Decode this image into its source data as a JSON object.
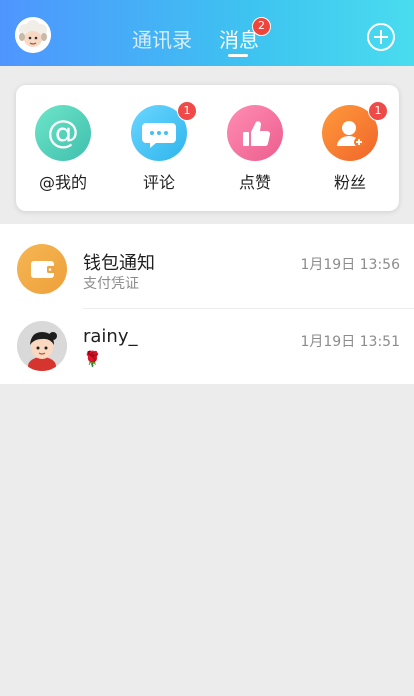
{
  "header": {
    "tabs": [
      {
        "label": "通讯录",
        "active": false
      },
      {
        "label": "消息",
        "active": true,
        "badge": "2"
      }
    ],
    "avatar_icon": "sheep-avatar",
    "add_icon": "plus-circle-icon"
  },
  "shortcuts": [
    {
      "label": "@我的",
      "icon": "at-icon",
      "color": "#4fd0b8",
      "badge": ""
    },
    {
      "label": "评论",
      "icon": "comment-icon",
      "color": "#3fc3f2",
      "badge": "1"
    },
    {
      "label": "点赞",
      "icon": "thumbs-up-icon",
      "color": "#f16b9a",
      "badge": ""
    },
    {
      "label": "粉丝",
      "icon": "fan-add-icon",
      "color": "#f57a2a",
      "badge": "1"
    }
  ],
  "messages": [
    {
      "title": "钱包通知",
      "subtitle": "支付凭证",
      "time": "1月19日 13:56",
      "avatar_icon": "wallet-icon"
    },
    {
      "title": "rainy_",
      "subtitle": "🌹",
      "time": "1月19日 13:51",
      "avatar_icon": "user-avatar"
    }
  ]
}
